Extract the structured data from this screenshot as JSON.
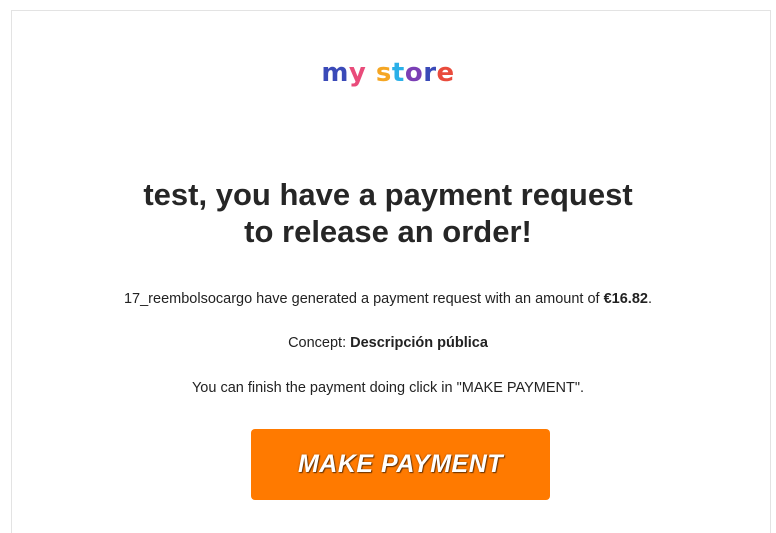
{
  "logo": {
    "letters": [
      {
        "char": "m",
        "color": "#3a4ab8"
      },
      {
        "char": "y",
        "color": "#e94b7a"
      },
      {
        "char": " ",
        "color": "#ffffff"
      },
      {
        "char": "s",
        "color": "#f5a623"
      },
      {
        "char": "t",
        "color": "#2bb0e8"
      },
      {
        "char": "o",
        "color": "#7b3fb5"
      },
      {
        "char": "r",
        "color": "#3a4ab8"
      },
      {
        "char": "e",
        "color": "#e94b3c"
      }
    ]
  },
  "email": {
    "headline_line1": "test, you have a payment request",
    "headline_line2": "to release an order!",
    "request_text_prefix": "17_reembolsocargo have generated a payment request with an amount of ",
    "amount": "€16.82",
    "request_text_suffix": ".",
    "concept_label": "Concept: ",
    "concept_value": "Descripción pública",
    "instruction": "You can finish the payment doing click in \"MAKE PAYMENT\"."
  },
  "button": {
    "label": "MAKE PAYMENT",
    "color": "#ff7a00"
  }
}
